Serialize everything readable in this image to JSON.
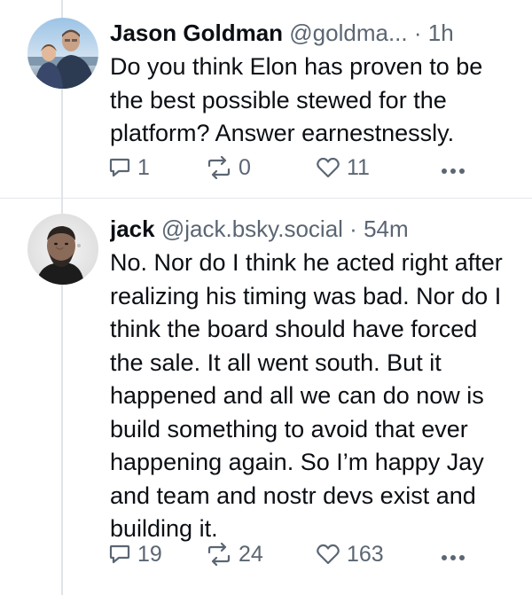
{
  "posts": [
    {
      "display_name": "Jason Goldman",
      "handle": "@goldma...",
      "separator": "·",
      "time": "1h",
      "text": "Do you think Elon has proven to be the best possible stewed for the platform? Answer earnestnessly.",
      "replies": "1",
      "reposts": "0",
      "likes": "11",
      "avatar_icon": "avatar-photo-adult-and-child"
    },
    {
      "display_name": "jack",
      "handle": "@jack.bsky.social",
      "separator": "·",
      "time": "54m",
      "text": "No. Nor do I think he acted right after realizing his timing was bad. Nor do I think the board should have forced the sale. It all went south. But it happened and all we can do now is build something to avoid that ever happening again. So I’m happy Jay and team and nostr devs exist and building it.",
      "replies": "19",
      "reposts": "24",
      "likes": "163",
      "avatar_icon": "avatar-photo-bearded-man"
    }
  ],
  "colors": {
    "text": "#0b0f14",
    "muted": "#5b6673",
    "divider": "#e3e6ea",
    "thread_line": "#dfe3e8"
  },
  "icons": [
    "reply-icon",
    "repost-icon",
    "like-icon",
    "more-options-icon"
  ]
}
